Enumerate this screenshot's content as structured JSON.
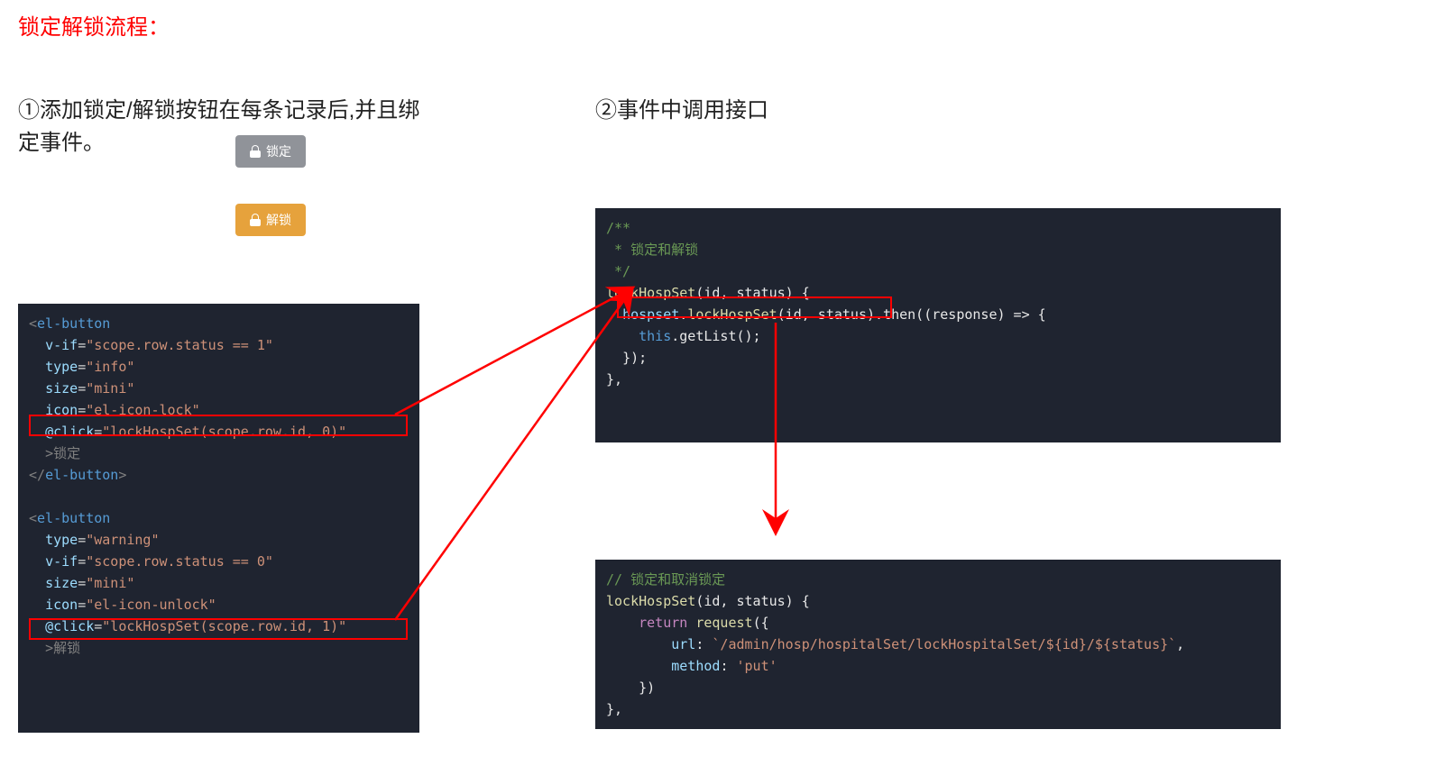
{
  "title": "锁定解锁流程：",
  "step1": {
    "heading": "①添加锁定/解锁按钮在每条记录后,并且绑定事件。",
    "btn_lock": "锁定",
    "btn_unlock": "解锁"
  },
  "step2": {
    "heading": "②事件中调用接口"
  },
  "code1": {
    "l1": "<el-button",
    "l2_attr": "v-if",
    "l2_val": "\"scope.row.status == 1\"",
    "l3_attr": "type",
    "l3_val": "\"info\"",
    "l4_attr": "size",
    "l4_val": "\"mini\"",
    "l5_attr": "icon",
    "l5_val": "\"el-icon-lock\"",
    "l6_attr": "@click",
    "l6_val": "\"lockHospSet(scope.row.id, 0)\"",
    "l7": ">锁定",
    "l8": "</el-button>",
    "l9": "<el-button",
    "l10_attr": "type",
    "l10_val": "\"warning\"",
    "l11_attr": "v-if",
    "l11_val": "\"scope.row.status == 0\"",
    "l12_attr": "size",
    "l12_val": "\"mini\"",
    "l13_attr": "icon",
    "l13_val": "\"el-icon-unlock\"",
    "l14_attr": "@click",
    "l14_val": "\"lockHospSet(scope.row.id, 1)\"",
    "l15": ">解锁"
  },
  "code2": {
    "c1": "/**",
    "c2": " * 锁定和解锁",
    "c3": " */",
    "fn": "lockHospSet",
    "args": "(id, status)",
    "call_obj": "hospset",
    "call_fn": "lockHospSet",
    "call_args": "(id, status)",
    "then": ".then((response) => {",
    "thisref": "this",
    "getlist": ".getList();",
    "end1": "});",
    "end2": "},"
  },
  "code3": {
    "c1": "// 锁定和取消锁定",
    "fn": "lockHospSet",
    "args": "(id, status)",
    "ret": "return",
    "req": "request",
    "open": "({",
    "url_key": "url",
    "url_val": "`/admin/hosp/hospitalSet/lockHospitalSet/${id}/${status}`",
    "method_key": "method",
    "method_val": "'put'",
    "close": "})",
    "end": "},"
  }
}
